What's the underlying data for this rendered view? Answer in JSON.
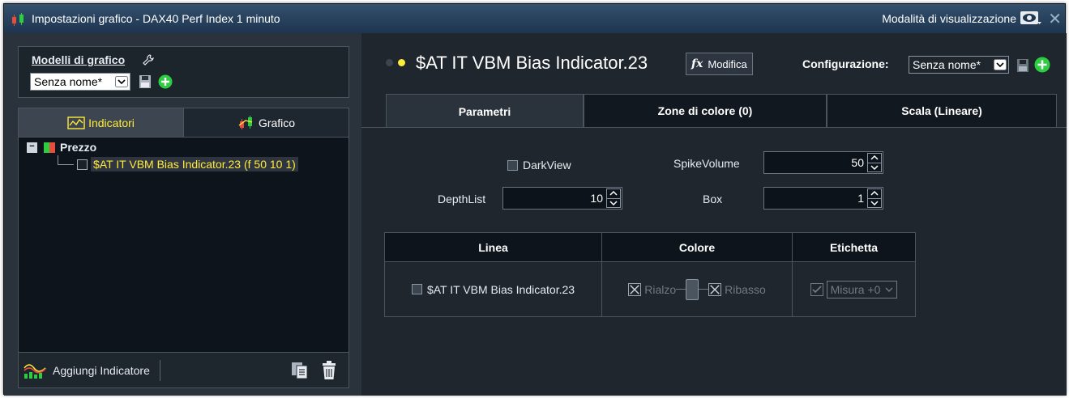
{
  "window": {
    "title": "Impostazioni grafico - DAX40 Perf Index 1 minuto",
    "view_mode": "Modalità di visualizzazione"
  },
  "left": {
    "models_label": "Modelli di grafico",
    "model_select": "Senza nome*",
    "tabs": [
      {
        "label": "Indicatori",
        "active": true
      },
      {
        "label": "Grafico",
        "active": false
      }
    ],
    "tree": {
      "root": "Prezzo",
      "child": "$AT IT VBM Bias Indicator.23 (f 50 10 1)"
    },
    "add_indicator": "Aggiungi Indicatore"
  },
  "right": {
    "indicator_title": "$AT IT VBM Bias Indicator.23",
    "modifica": "Modifica",
    "config_label": "Configurazione:",
    "config_select": "Senza nome*",
    "tabs": [
      {
        "label": "Parametri",
        "active": true
      },
      {
        "label": "Zone di colore (0)",
        "active": false
      },
      {
        "label": "Scala (Lineare)",
        "active": false
      }
    ],
    "params": {
      "darkview": "DarkView",
      "spikevolume_label": "SpikeVolume",
      "spikevolume_value": "50",
      "depthlist_label": "DepthList",
      "depthlist_value": "10",
      "box_label": "Box",
      "box_value": "1"
    },
    "table": {
      "headers": [
        "Linea",
        "Colore",
        "Etichetta"
      ],
      "row": {
        "line": "$AT IT VBM Bias Indicator.23",
        "rialzo": "Rialzo",
        "ribasso": "Ribasso",
        "misura": "Misura +0"
      }
    }
  },
  "colors": {
    "accent_yellow": "#ffeb3b",
    "title_bar": "#2a4560",
    "add_green": "#2ecc40"
  }
}
